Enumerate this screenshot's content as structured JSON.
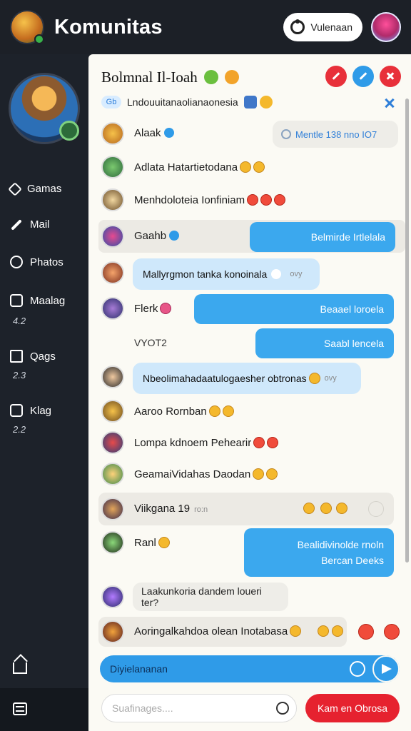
{
  "header": {
    "title": "Komunitas",
    "action_label": "Vulenaan"
  },
  "sidebar": {
    "items": [
      {
        "label": "Gamas",
        "count": ""
      },
      {
        "label": "Mail",
        "count": ""
      },
      {
        "label": "Phatos",
        "count": ""
      },
      {
        "label": "Maalag",
        "count": "4.2"
      },
      {
        "label": "Qags",
        "count": "2.3"
      },
      {
        "label": "Klag",
        "count": "2.2"
      }
    ]
  },
  "chat": {
    "title": "Bolmnal Il-Ioah",
    "subtitle_badge": "Gb",
    "subtitle": "Lndouuitanaolianaonesia"
  },
  "messages": [
    {
      "name": "Alaak",
      "pill": "Mentle 138 nno IO7"
    },
    {
      "name": "Adlata Hatartietodana"
    },
    {
      "name": "Menhdoloteia Ionfiniam"
    },
    {
      "name": "Gaahb",
      "bubble": "Belmirde Irtlelala"
    },
    {
      "bubble": "Mallyrgmon tanka konoinala",
      "meta": "ovy"
    },
    {
      "name": "Flerk",
      "bubble": "Beaael loroela"
    },
    {
      "name": "VYOT2",
      "bubble": "Saabl lencela"
    },
    {
      "bubble": "Nbeolimahadaatulogaesher obtronas",
      "meta": "ovy"
    },
    {
      "name": "Aaroo Rornban"
    },
    {
      "name": "Lompa kdnoem Pehearir"
    },
    {
      "name": "GeamaiVidahas Daodan"
    },
    {
      "name": "Viikgana 19",
      "meta": "ro:n"
    },
    {
      "name": "Ranl",
      "bubble_line1": "Bealidivinolde rnoln",
      "bubble_line2": "Bercan Deeks"
    },
    {
      "bubble": "Laakunkoria dandem loueri ter?"
    },
    {
      "name": "Aoringalkahdoa olean Inotabasa"
    }
  ],
  "composer": {
    "value": "Diyielananan",
    "search_placeholder": "Suafinages....",
    "action_label": "Kam en Obrosa"
  },
  "colors": {
    "accent_blue": "#3ba8ee",
    "accent_red": "#e6222f",
    "sidebar_bg": "#1d222a",
    "chat_bg": "#fbfaf4"
  }
}
